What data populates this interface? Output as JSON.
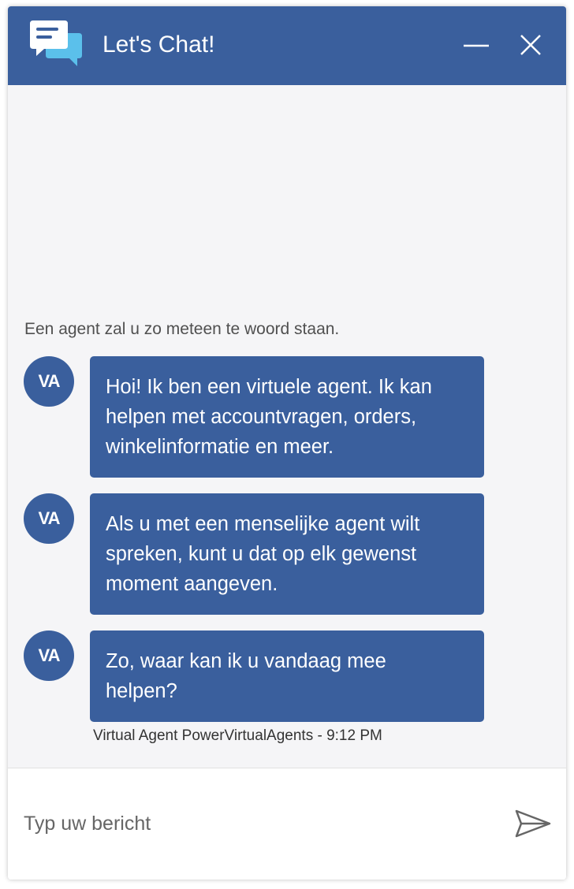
{
  "header": {
    "title": "Let's Chat!",
    "logo_icon": "chat-bubbles-icon",
    "minimize_icon": "minimize-icon",
    "close_icon": "close-icon",
    "background_color": "#3a5f9d"
  },
  "messages": {
    "system_note": "Een agent zal u zo meteen te woord staan.",
    "items": [
      {
        "avatar": "VA",
        "lines": [
          "Hoi! Ik ben een virtuele agent. Ik kan",
          "helpen met accountvragen, orders,",
          "winkelinformatie en meer."
        ]
      },
      {
        "avatar": "VA",
        "lines": [
          "Als u met een menselijke agent wilt",
          "spreken, kunt u dat op elk gewenst",
          "moment aangeven."
        ]
      },
      {
        "avatar": "VA",
        "lines": [
          "Zo, waar kan ik u vandaag mee",
          "helpen?"
        ]
      }
    ],
    "meta": "Virtual Agent PowerVirtualAgents - 9:12 PM"
  },
  "composer": {
    "placeholder": "Typ uw bericht",
    "value": "",
    "send_icon": "send-icon"
  }
}
